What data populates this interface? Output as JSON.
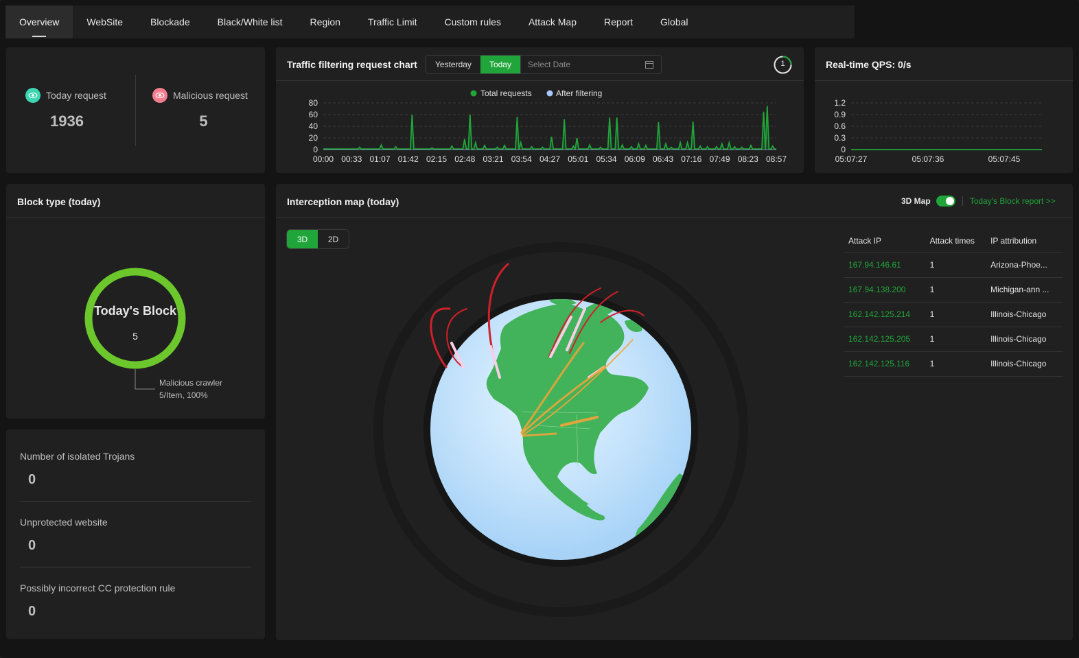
{
  "tabs": [
    "Overview",
    "WebSite",
    "Blockade",
    "Black/White list",
    "Region",
    "Traffic Limit",
    "Custom rules",
    "Attack Map",
    "Report",
    "Global"
  ],
  "active_tab": "Overview",
  "stats": {
    "today_request": {
      "label": "Today request",
      "value": "1936"
    },
    "malicious_request": {
      "label": "Malicious request",
      "value": "5"
    }
  },
  "traffic_chart": {
    "title": "Traffic filtering request chart",
    "buttons": {
      "yesterday": "Yesterday",
      "today": "Today"
    },
    "date_placeholder": "Select Date",
    "refresh_countdown": "1",
    "legend": [
      "Total requests",
      "After filtering"
    ]
  },
  "qps": {
    "title": "Real-time QPS: 0/s"
  },
  "block_type": {
    "title": "Block type (today)",
    "center_title": "Today's Block",
    "center_value": "5",
    "callout_name": "Malicious crawler",
    "callout_detail": "5/Item, 100%"
  },
  "metrics": [
    {
      "label": "Number of isolated Trojans",
      "value": "0"
    },
    {
      "label": "Unprotected website",
      "value": "0"
    },
    {
      "label": "Possibly incorrect CC protection rule",
      "value": "0"
    }
  ],
  "interception_map": {
    "title": "Interception map (today)",
    "toggle_label": "3D Map",
    "toggle_on": true,
    "report_link": "Today's Block report >>",
    "view_buttons": [
      "3D",
      "2D"
    ],
    "active_view": "3D",
    "columns": [
      "Attack IP",
      "Attack times",
      "IP attribution"
    ],
    "rows": [
      {
        "ip": "167.94.146.61",
        "times": "1",
        "attribution": "Arizona-Phoe..."
      },
      {
        "ip": "167.94.138.200",
        "times": "1",
        "attribution": "Michigan-ann ..."
      },
      {
        "ip": "162.142.125.214",
        "times": "1",
        "attribution": "Illinois-Chicago"
      },
      {
        "ip": "162.142.125.205",
        "times": "1",
        "attribution": "Illinois-Chicago"
      },
      {
        "ip": "162.142.125.116",
        "times": "1",
        "attribution": "Illinois-Chicago"
      }
    ]
  },
  "colors": {
    "accent": "#20a53a",
    "donut": "#6bc72b",
    "after_filter": "#a6c8ff",
    "arc_red": "#d0202a",
    "arc_orange": "#f3a33a"
  },
  "chart_data": [
    {
      "type": "line",
      "x_ticks": [
        "00:00",
        "00:33",
        "01:07",
        "01:42",
        "02:15",
        "02:48",
        "03:21",
        "03:54",
        "04:27",
        "05:01",
        "05:34",
        "06:09",
        "06:43",
        "07:16",
        "07:49",
        "08:23",
        "08:57"
      ],
      "y_ticks": [
        0,
        20,
        40,
        60,
        80
      ],
      "ylim": [
        0,
        80
      ],
      "series": [
        {
          "name": "Total requests",
          "spikes": [
            [
              0.1,
              4
            ],
            [
              0.16,
              8
            ],
            [
              0.2,
              5
            ],
            [
              0.245,
              60
            ],
            [
              0.3,
              3
            ],
            [
              0.355,
              6
            ],
            [
              0.39,
              18
            ],
            [
              0.405,
              60
            ],
            [
              0.42,
              12
            ],
            [
              0.445,
              7
            ],
            [
              0.48,
              4
            ],
            [
              0.5,
              7
            ],
            [
              0.535,
              56
            ],
            [
              0.545,
              12
            ],
            [
              0.575,
              5
            ],
            [
              0.605,
              4
            ],
            [
              0.63,
              22
            ],
            [
              0.665,
              52
            ],
            [
              0.69,
              6
            ],
            [
              0.7,
              20
            ],
            [
              0.735,
              8
            ],
            [
              0.765,
              4
            ],
            [
              0.79,
              55
            ],
            [
              0.81,
              55
            ],
            [
              0.825,
              8
            ],
            [
              0.85,
              5
            ],
            [
              0.87,
              10
            ],
            [
              0.89,
              7
            ],
            [
              0.925,
              47
            ],
            [
              0.945,
              10
            ],
            [
              0.96,
              4
            ],
            [
              0.985,
              12
            ],
            [
              1.005,
              12
            ],
            [
              1.02,
              48
            ],
            [
              1.04,
              6
            ],
            [
              1.06,
              5
            ],
            [
              1.085,
              5
            ],
            [
              1.1,
              10
            ],
            [
              1.12,
              12
            ],
            [
              1.135,
              5
            ],
            [
              1.155,
              4
            ],
            [
              1.18,
              7
            ],
            [
              1.215,
              65
            ],
            [
              1.225,
              75
            ],
            [
              1.24,
              6
            ]
          ],
          "base": 1
        },
        {
          "name": "After filtering",
          "values": [
            0
          ]
        }
      ]
    },
    {
      "type": "line",
      "x_ticks": [
        "05:07:27",
        "05:07:36",
        "05:07:45"
      ],
      "y_ticks": [
        0,
        0.3,
        0.6,
        0.9,
        1.2
      ],
      "ylim": [
        0,
        1.2
      ],
      "series": [
        {
          "name": "QPS",
          "values": [
            0,
            0,
            0,
            0,
            0,
            0,
            0,
            0,
            0,
            0
          ]
        }
      ]
    },
    {
      "type": "pie",
      "slices": [
        {
          "name": "Malicious crawler",
          "value": 5,
          "percent": 100
        }
      ]
    }
  ]
}
